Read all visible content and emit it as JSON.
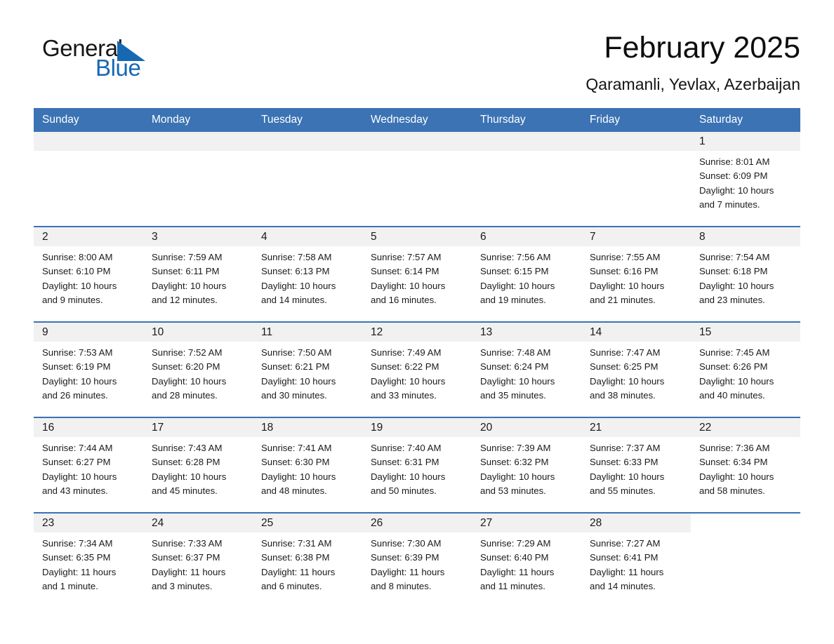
{
  "brand": {
    "name_part1": "General",
    "name_part2": "Blue",
    "triangle_color": "#1668b3",
    "accent_color": "#3b73b4"
  },
  "header": {
    "title": "February 2025",
    "location": "Qaramanli, Yevlax, Azerbaijan"
  },
  "weekday_headers": [
    "Sunday",
    "Monday",
    "Tuesday",
    "Wednesday",
    "Thursday",
    "Friday",
    "Saturday"
  ],
  "labels": {
    "sunrise_prefix": "Sunrise:",
    "sunset_prefix": "Sunset:",
    "daylight_prefix": "Daylight:"
  },
  "weeks": [
    [
      {
        "day": "",
        "sunrise": "",
        "sunset": "",
        "daylight": "",
        "blank": true
      },
      {
        "day": "",
        "sunrise": "",
        "sunset": "",
        "daylight": "",
        "blank": true
      },
      {
        "day": "",
        "sunrise": "",
        "sunset": "",
        "daylight": "",
        "blank": true
      },
      {
        "day": "",
        "sunrise": "",
        "sunset": "",
        "daylight": "",
        "blank": true
      },
      {
        "day": "",
        "sunrise": "",
        "sunset": "",
        "daylight": "",
        "blank": true
      },
      {
        "day": "",
        "sunrise": "",
        "sunset": "",
        "daylight": "",
        "blank": true
      },
      {
        "day": "1",
        "sunrise": "Sunrise: 8:01 AM",
        "sunset": "Sunset: 6:09 PM",
        "daylight": "Daylight: 10 hours and 7 minutes."
      }
    ],
    [
      {
        "day": "2",
        "sunrise": "Sunrise: 8:00 AM",
        "sunset": "Sunset: 6:10 PM",
        "daylight": "Daylight: 10 hours and 9 minutes."
      },
      {
        "day": "3",
        "sunrise": "Sunrise: 7:59 AM",
        "sunset": "Sunset: 6:11 PM",
        "daylight": "Daylight: 10 hours and 12 minutes."
      },
      {
        "day": "4",
        "sunrise": "Sunrise: 7:58 AM",
        "sunset": "Sunset: 6:13 PM",
        "daylight": "Daylight: 10 hours and 14 minutes."
      },
      {
        "day": "5",
        "sunrise": "Sunrise: 7:57 AM",
        "sunset": "Sunset: 6:14 PM",
        "daylight": "Daylight: 10 hours and 16 minutes."
      },
      {
        "day": "6",
        "sunrise": "Sunrise: 7:56 AM",
        "sunset": "Sunset: 6:15 PM",
        "daylight": "Daylight: 10 hours and 19 minutes."
      },
      {
        "day": "7",
        "sunrise": "Sunrise: 7:55 AM",
        "sunset": "Sunset: 6:16 PM",
        "daylight": "Daylight: 10 hours and 21 minutes."
      },
      {
        "day": "8",
        "sunrise": "Sunrise: 7:54 AM",
        "sunset": "Sunset: 6:18 PM",
        "daylight": "Daylight: 10 hours and 23 minutes."
      }
    ],
    [
      {
        "day": "9",
        "sunrise": "Sunrise: 7:53 AM",
        "sunset": "Sunset: 6:19 PM",
        "daylight": "Daylight: 10 hours and 26 minutes."
      },
      {
        "day": "10",
        "sunrise": "Sunrise: 7:52 AM",
        "sunset": "Sunset: 6:20 PM",
        "daylight": "Daylight: 10 hours and 28 minutes."
      },
      {
        "day": "11",
        "sunrise": "Sunrise: 7:50 AM",
        "sunset": "Sunset: 6:21 PM",
        "daylight": "Daylight: 10 hours and 30 minutes."
      },
      {
        "day": "12",
        "sunrise": "Sunrise: 7:49 AM",
        "sunset": "Sunset: 6:22 PM",
        "daylight": "Daylight: 10 hours and 33 minutes."
      },
      {
        "day": "13",
        "sunrise": "Sunrise: 7:48 AM",
        "sunset": "Sunset: 6:24 PM",
        "daylight": "Daylight: 10 hours and 35 minutes."
      },
      {
        "day": "14",
        "sunrise": "Sunrise: 7:47 AM",
        "sunset": "Sunset: 6:25 PM",
        "daylight": "Daylight: 10 hours and 38 minutes."
      },
      {
        "day": "15",
        "sunrise": "Sunrise: 7:45 AM",
        "sunset": "Sunset: 6:26 PM",
        "daylight": "Daylight: 10 hours and 40 minutes."
      }
    ],
    [
      {
        "day": "16",
        "sunrise": "Sunrise: 7:44 AM",
        "sunset": "Sunset: 6:27 PM",
        "daylight": "Daylight: 10 hours and 43 minutes."
      },
      {
        "day": "17",
        "sunrise": "Sunrise: 7:43 AM",
        "sunset": "Sunset: 6:28 PM",
        "daylight": "Daylight: 10 hours and 45 minutes."
      },
      {
        "day": "18",
        "sunrise": "Sunrise: 7:41 AM",
        "sunset": "Sunset: 6:30 PM",
        "daylight": "Daylight: 10 hours and 48 minutes."
      },
      {
        "day": "19",
        "sunrise": "Sunrise: 7:40 AM",
        "sunset": "Sunset: 6:31 PM",
        "daylight": "Daylight: 10 hours and 50 minutes."
      },
      {
        "day": "20",
        "sunrise": "Sunrise: 7:39 AM",
        "sunset": "Sunset: 6:32 PM",
        "daylight": "Daylight: 10 hours and 53 minutes."
      },
      {
        "day": "21",
        "sunrise": "Sunrise: 7:37 AM",
        "sunset": "Sunset: 6:33 PM",
        "daylight": "Daylight: 10 hours and 55 minutes."
      },
      {
        "day": "22",
        "sunrise": "Sunrise: 7:36 AM",
        "sunset": "Sunset: 6:34 PM",
        "daylight": "Daylight: 10 hours and 58 minutes."
      }
    ],
    [
      {
        "day": "23",
        "sunrise": "Sunrise: 7:34 AM",
        "sunset": "Sunset: 6:35 PM",
        "daylight": "Daylight: 11 hours and 1 minute."
      },
      {
        "day": "24",
        "sunrise": "Sunrise: 7:33 AM",
        "sunset": "Sunset: 6:37 PM",
        "daylight": "Daylight: 11 hours and 3 minutes."
      },
      {
        "day": "25",
        "sunrise": "Sunrise: 7:31 AM",
        "sunset": "Sunset: 6:38 PM",
        "daylight": "Daylight: 11 hours and 6 minutes."
      },
      {
        "day": "26",
        "sunrise": "Sunrise: 7:30 AM",
        "sunset": "Sunset: 6:39 PM",
        "daylight": "Daylight: 11 hours and 8 minutes."
      },
      {
        "day": "27",
        "sunrise": "Sunrise: 7:29 AM",
        "sunset": "Sunset: 6:40 PM",
        "daylight": "Daylight: 11 hours and 11 minutes."
      },
      {
        "day": "28",
        "sunrise": "Sunrise: 7:27 AM",
        "sunset": "Sunset: 6:41 PM",
        "daylight": "Daylight: 11 hours and 14 minutes."
      },
      {
        "day": "",
        "sunrise": "",
        "sunset": "",
        "daylight": "",
        "blank": true
      }
    ]
  ]
}
